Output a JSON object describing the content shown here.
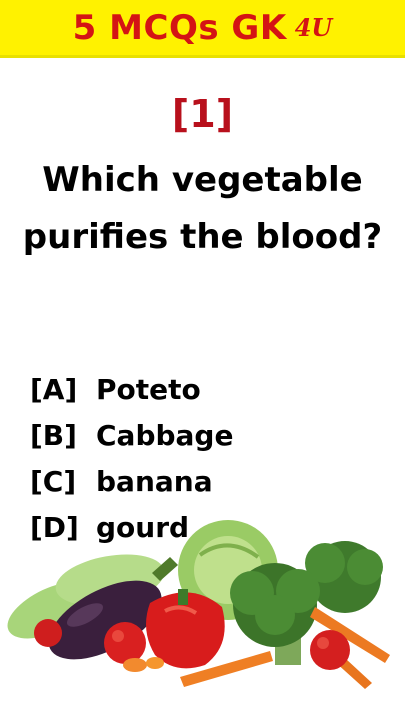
{
  "banner": {
    "title": "5 MCQs GK",
    "tag": "4U"
  },
  "question": {
    "number": "[1]",
    "text": "Which vegetable purifies the blood?"
  },
  "options": [
    {
      "letter": "[A]",
      "text": "Poteto"
    },
    {
      "letter": "[B]",
      "text": "Cabbage"
    },
    {
      "letter": "[C]",
      "text": "banana"
    },
    {
      "letter": "[D]",
      "text": "gourd"
    }
  ],
  "colors": {
    "banner_bg": "#fff200",
    "banner_text": "#d41414",
    "number": "#b8101c",
    "text": "#000000"
  },
  "illustration": "vegetables-image"
}
